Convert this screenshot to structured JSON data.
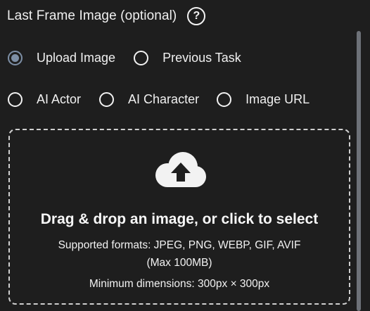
{
  "header": {
    "title": "Last Frame Image (optional)",
    "help_icon": "?"
  },
  "source_options": {
    "row1": [
      {
        "label": "Upload Image",
        "checked": true
      },
      {
        "label": "Previous Task",
        "checked": false
      }
    ],
    "row2": [
      {
        "label": "AI Actor",
        "checked": false
      },
      {
        "label": "AI Character",
        "checked": false
      },
      {
        "label": "Image URL",
        "checked": false
      }
    ]
  },
  "dropzone": {
    "icon": "cloud-upload-icon",
    "title": "Drag & drop an image, or click to select",
    "formats": "Supported formats: JPEG, PNG, WEBP, GIF, AVIF",
    "max_size": "(Max 100MB)",
    "min_dimensions": "Minimum dimensions: 300px × 300px"
  },
  "colors": {
    "background": "#1e1e1e",
    "text": "#f2f2f2",
    "radio_selected": "#7d8fa6",
    "dashed_border": "#cfcfcf",
    "scrollbar": "#6d7178"
  }
}
